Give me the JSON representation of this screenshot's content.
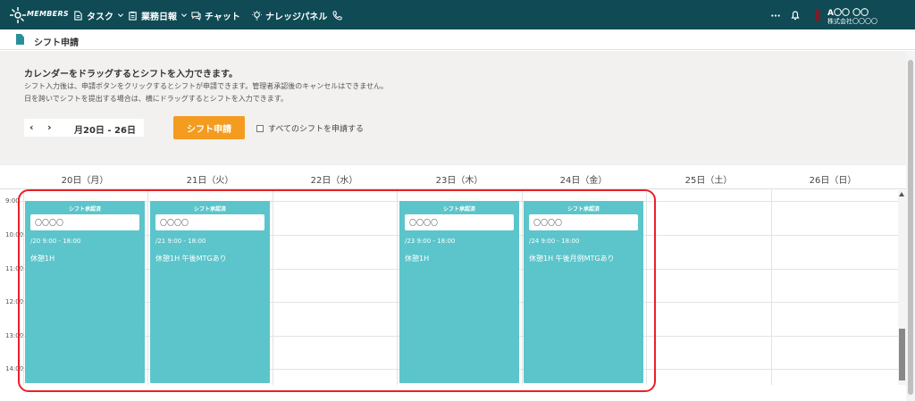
{
  "app": {
    "logo_text": "MEMBERS",
    "nav": [
      {
        "label": "タスク",
        "icon": "document-icon",
        "has_chevron": true
      },
      {
        "label": "業務日報",
        "icon": "clipboard-icon",
        "has_chevron": true
      },
      {
        "label": "チャット",
        "icon": "chat-icon",
        "has_chevron": false
      },
      {
        "label": "ナレッジパネル",
        "icon": "lightbulb-icon",
        "has_chevron": false
      }
    ],
    "phone_icon": "phone-icon",
    "more_icon": "ellipsis-icon",
    "bell_icon": "bell-icon",
    "user": {
      "name": "A〇〇 〇〇",
      "company": "株式会社〇〇〇〇"
    }
  },
  "page": {
    "title": "シフト申請",
    "title_icon": "document-icon"
  },
  "instructions": {
    "heading": "カレンダーをドラッグするとシフトを入力できます。",
    "line1": "シフト入力後は、申請ボタンをクリックするとシフトが申請できます。管理者承認後のキャンセルはできません。",
    "line2": "日を跨いでシフトを提出する場合は、横にドラッグするとシフトを入力できます。"
  },
  "toolbar": {
    "prev_label": "‹",
    "next_label": "›",
    "date_range": "月20日 - 26日",
    "submit_label": "シフト申請",
    "submit_all_label": "すべてのシフトを申請する",
    "submit_all_checked": false
  },
  "days": [
    "20日（月）",
    "21日（火）",
    "22日（水）",
    "23日（木）",
    "24日（金）",
    "25日（土）",
    "26日（日）"
  ],
  "times": [
    "9:00",
    "10:00",
    "11:00",
    "12:00",
    "13:00",
    "14:00"
  ],
  "events": [
    {
      "day_index": 0,
      "status": "シフト承認済",
      "name": "〇〇〇〇",
      "time": "/20 9:00 - 18:00",
      "note": "休憩1H"
    },
    {
      "day_index": 1,
      "status": "シフト承認済",
      "name": "〇〇〇〇",
      "time": "/21 9:00 - 18:00",
      "note": "休憩1H 午後MTGあり"
    },
    {
      "day_index": 3,
      "status": "シフト承認済",
      "name": "〇〇〇〇",
      "time": "/23 9:00 - 18:00",
      "note": "休憩1H"
    },
    {
      "day_index": 4,
      "status": "シフト承認済",
      "name": "〇〇〇〇",
      "time": "/24 9:00 - 18:00",
      "note": "休憩1H 午後月例MTGあり"
    }
  ],
  "colors": {
    "nav_bg": "#0f4a55",
    "event_bg": "#5bc5cb",
    "submit_bg": "#f39c1f",
    "highlight": "#e8202a"
  }
}
